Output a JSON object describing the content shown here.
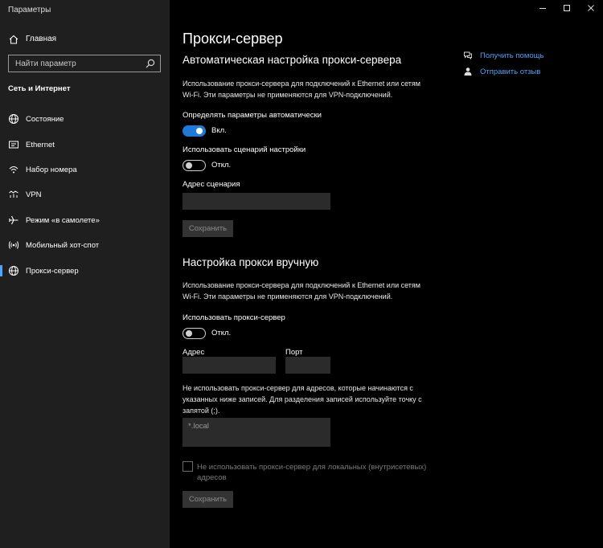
{
  "app": {
    "title": "Параметры"
  },
  "window_controls": {
    "minimize_icon": "minimize-icon",
    "maximize_icon": "maximize-icon",
    "close_icon": "close-icon"
  },
  "sidebar": {
    "home_label": "Главная",
    "search_placeholder": "Найти параметр",
    "section_title": "Сеть и Интернет",
    "items": [
      {
        "label": "Состояние",
        "icon": "globe-icon"
      },
      {
        "label": "Ethernet",
        "icon": "ethernet-icon"
      },
      {
        "label": "Набор номера",
        "icon": "dialup-icon"
      },
      {
        "label": "VPN",
        "icon": "vpn-icon"
      },
      {
        "label": "Режим «в самолете»",
        "icon": "airplane-icon"
      },
      {
        "label": "Мобильный хот-спот",
        "icon": "hotspot-icon"
      },
      {
        "label": "Прокси-сервер",
        "icon": "globe-icon",
        "selected": true
      }
    ]
  },
  "main": {
    "page_title": "Прокси-сервер",
    "auto": {
      "heading": "Автоматическая настройка прокси-сервера",
      "description": "Использование прокси-сервера для подключений к Ethernet или сетям Wi-Fi. Эти параметры не применяются для VPN-подключений.",
      "detect_label": "Определять параметры автоматически",
      "detect_state": "Вкл.",
      "detect_on": true,
      "script_label": "Использовать сценарий настройки",
      "script_state": "Откл.",
      "script_on": false,
      "script_address_label": "Адрес сценария",
      "script_address_value": "",
      "save_label": "Сохранить"
    },
    "manual": {
      "heading": "Настройка прокси вручную",
      "description": "Использование прокси-сервера для подключений к Ethernet или сетям Wi-Fi. Эти параметры не применяются для VPN-подключений.",
      "use_proxy_label": "Использовать прокси-сервер",
      "use_proxy_state": "Откл.",
      "use_proxy_on": false,
      "address_label": "Адрес",
      "address_value": "",
      "port_label": "Порт",
      "port_value": "",
      "exceptions_description": "Не использовать прокси-сервер для адресов, которые начинаются с указанных ниже записей. Для разделения записей используйте точку с запятой (;).",
      "exceptions_value": "*.local",
      "local_checkbox_label": "Не использовать прокси-сервер для локальных (внутрисетевых) адресов",
      "local_checkbox_checked": false,
      "save_label": "Сохранить"
    }
  },
  "help": {
    "get_help_label": "Получить помощь",
    "feedback_label": "Отправить отзыв"
  },
  "colors": {
    "accent": "#1f79d6",
    "link": "#4aa3f5",
    "sidebar_bg": "#1f1f1f",
    "main_bg": "#000000"
  }
}
